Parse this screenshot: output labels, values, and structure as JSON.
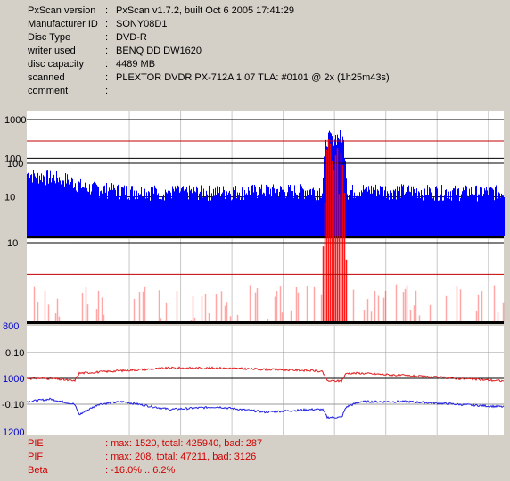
{
  "info": [
    {
      "label": "PxScan version",
      "value": "PxScan v1.7.2, built Oct  6 2005 17:41:29"
    },
    {
      "label": "Manufacturer ID",
      "value": "SONY08D1"
    },
    {
      "label": "Disc Type",
      "value": "DVD-R"
    },
    {
      "label": "writer used",
      "value": "BENQ DD DW1620"
    },
    {
      "label": "disc capacity",
      "value": "4489 MB"
    },
    {
      "label": "scanned",
      "value": "PLEXTOR DVDR  PX-712A 1.07 TLA: #0101 @ 2x (1h25m43s)"
    },
    {
      "label": "comment",
      "value": ""
    }
  ],
  "colon": ":",
  "summary": [
    {
      "label": "PIE",
      "value": ": max: 1520, total: 425940, bad: 287"
    },
    {
      "label": "PIF",
      "value": ": max: 208, total: 47211, bad: 3126"
    },
    {
      "label": "Beta",
      "value": ": -16.0% .. 6.2%"
    }
  ],
  "colors": {
    "pie": "#0000ff",
    "pif": "#ff0000",
    "beta_top": "#e02020",
    "beta_bottom": "#2020e0",
    "threshold": "#c00000",
    "grid": "#000000",
    "panel_bg": "#ffffff",
    "marker_text": "#0000cc"
  },
  "chart_data": [
    {
      "type": "area",
      "name": "PIE",
      "yscale": "log",
      "ylim": [
        1,
        1520
      ],
      "y_ticks": [
        "1000",
        "100",
        "10"
      ],
      "threshold": 280,
      "series": [
        {
          "x": [
            0,
            0.03,
            0.08,
            0.12,
            0.2,
            0.3,
            0.4,
            0.5,
            0.6,
            0.62,
            0.63,
            0.66,
            0.67,
            0.7,
            0.8,
            0.9,
            1.0
          ],
          "values": [
            40,
            35,
            30,
            18,
            15,
            14,
            14,
            15,
            15,
            15,
            350,
            380,
            14,
            16,
            15,
            14,
            14
          ]
        }
      ]
    },
    {
      "type": "bar",
      "name": "PIF",
      "yscale": "log",
      "ylim": [
        1,
        208
      ],
      "y_ticks": [
        "100",
        "10"
      ],
      "threshold": 4,
      "series": [
        {
          "x": [
            0,
            0.1,
            0.2,
            0.3,
            0.4,
            0.5,
            0.6,
            0.62,
            0.63,
            0.66,
            0.67,
            0.8,
            1.0
          ],
          "values": [
            1,
            2,
            1,
            2,
            1,
            2,
            1,
            2,
            208,
            120,
            2,
            2,
            1
          ]
        }
      ]
    },
    {
      "type": "line",
      "name": "Beta",
      "y_ticks": [
        "0.10",
        "-0.10"
      ],
      "ylim": [
        -0.16,
        0.062
      ],
      "series": [
        {
          "x": [
            0,
            0.05,
            0.1,
            0.11,
            0.2,
            0.3,
            0.4,
            0.5,
            0.6,
            0.62,
            0.63,
            0.66,
            0.67,
            0.7,
            0.8,
            0.9,
            1.0
          ],
          "values": [
            0.0,
            0.0,
            -0.01,
            0.02,
            0.03,
            0.04,
            0.04,
            0.035,
            0.03,
            0.025,
            -0.01,
            -0.01,
            0.02,
            0.02,
            0.01,
            0.0,
            -0.01
          ]
        },
        {
          "x": [
            0,
            0.05,
            0.1,
            0.11,
            0.15,
            0.2,
            0.3,
            0.4,
            0.5,
            0.6,
            0.62,
            0.63,
            0.66,
            0.67,
            0.7,
            0.8,
            0.9,
            1.0
          ],
          "values": [
            -0.09,
            -0.08,
            -0.1,
            -0.14,
            -0.1,
            -0.09,
            -0.12,
            -0.11,
            -0.13,
            -0.12,
            -0.12,
            -0.15,
            -0.15,
            -0.11,
            -0.09,
            -0.09,
            -0.1,
            -0.11
          ]
        }
      ]
    }
  ],
  "markers": [
    "800",
    "1000",
    "1200"
  ]
}
